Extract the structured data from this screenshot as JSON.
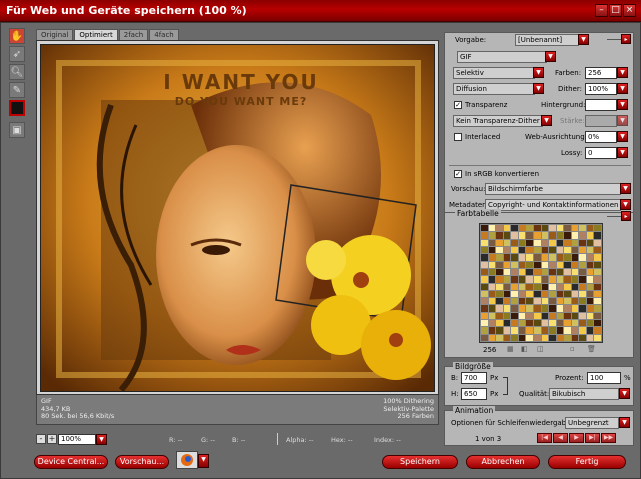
{
  "window": {
    "title": "Für Web und Geräte speichern (100 %)"
  },
  "tabs": [
    "Original",
    "Optimiert",
    "2fach",
    "4fach"
  ],
  "active_tab": 1,
  "artwork": {
    "line1": "I WANT YOU",
    "line2": "DO YOU WANT ME?"
  },
  "info": {
    "left": [
      "GIF",
      "434,7 KB",
      "80 Sek. bei 56,6 Kbit/s"
    ],
    "right": [
      "100% Dithering",
      "Selektiv-Palette",
      "256 Farben"
    ]
  },
  "status": {
    "zoom": "100%",
    "r": "R: --",
    "g": "G: --",
    "b": "B: --",
    "alpha": "Alpha: --",
    "hex": "Hex: --",
    "index": "Index: --"
  },
  "settings": {
    "preset_label": "Vorgabe:",
    "preset_value": "[Unbenannt]",
    "format": "GIF",
    "reduction": "Selektiv",
    "colors_label": "Farben:",
    "colors_value": "256",
    "dither_algo": "Diffusion",
    "dither_label": "Dither:",
    "dither_value": "100%",
    "transparency_label": "Transparenz",
    "transparency_checked": "✓",
    "matte_label": "Hintergrund:",
    "transparency_dither": "Kein Transparenz-Dither",
    "amount_label": "Stärke:",
    "interlaced_label": "Interlaced",
    "interlaced_checked": "",
    "websnap_label": "Web-Ausrichtung:",
    "websnap_value": "0%",
    "lossy_label": "Lossy:",
    "lossy_value": "0",
    "srgb_label": "In sRGB konvertieren",
    "srgb_checked": "✓",
    "preview_label": "Vorschau:",
    "preview_value": "Bildschirmfarbe",
    "metadata_label": "Metadaten:",
    "metadata_value": "Copyright- und Kontaktinformationen"
  },
  "color_table": {
    "title": "Farbtabelle",
    "count": "256"
  },
  "image_size": {
    "title": "Bildgröße",
    "w_label": "B:",
    "w_value": "700",
    "w_unit": "Px",
    "h_label": "H:",
    "h_value": "650",
    "h_unit": "Px",
    "percent_label": "Prozent:",
    "percent_value": "100",
    "percent_unit": "%",
    "quality_label": "Qualität:",
    "quality_value": "Bikubisch"
  },
  "animation": {
    "title": "Animation",
    "loop_label": "Optionen für Schleifenwiedergabe:",
    "loop_value": "Unbegrenzt",
    "frame_counter": "1 von 3"
  },
  "buttons": {
    "device_central": "Device Central...",
    "preview": "Vorschau...",
    "save": "Speichern",
    "cancel": "Abbrechen",
    "done": "Fertig"
  },
  "colors": {
    "accent": "#c00000",
    "panel": "#b6b6b6",
    "bg": "#6e6e6e"
  }
}
